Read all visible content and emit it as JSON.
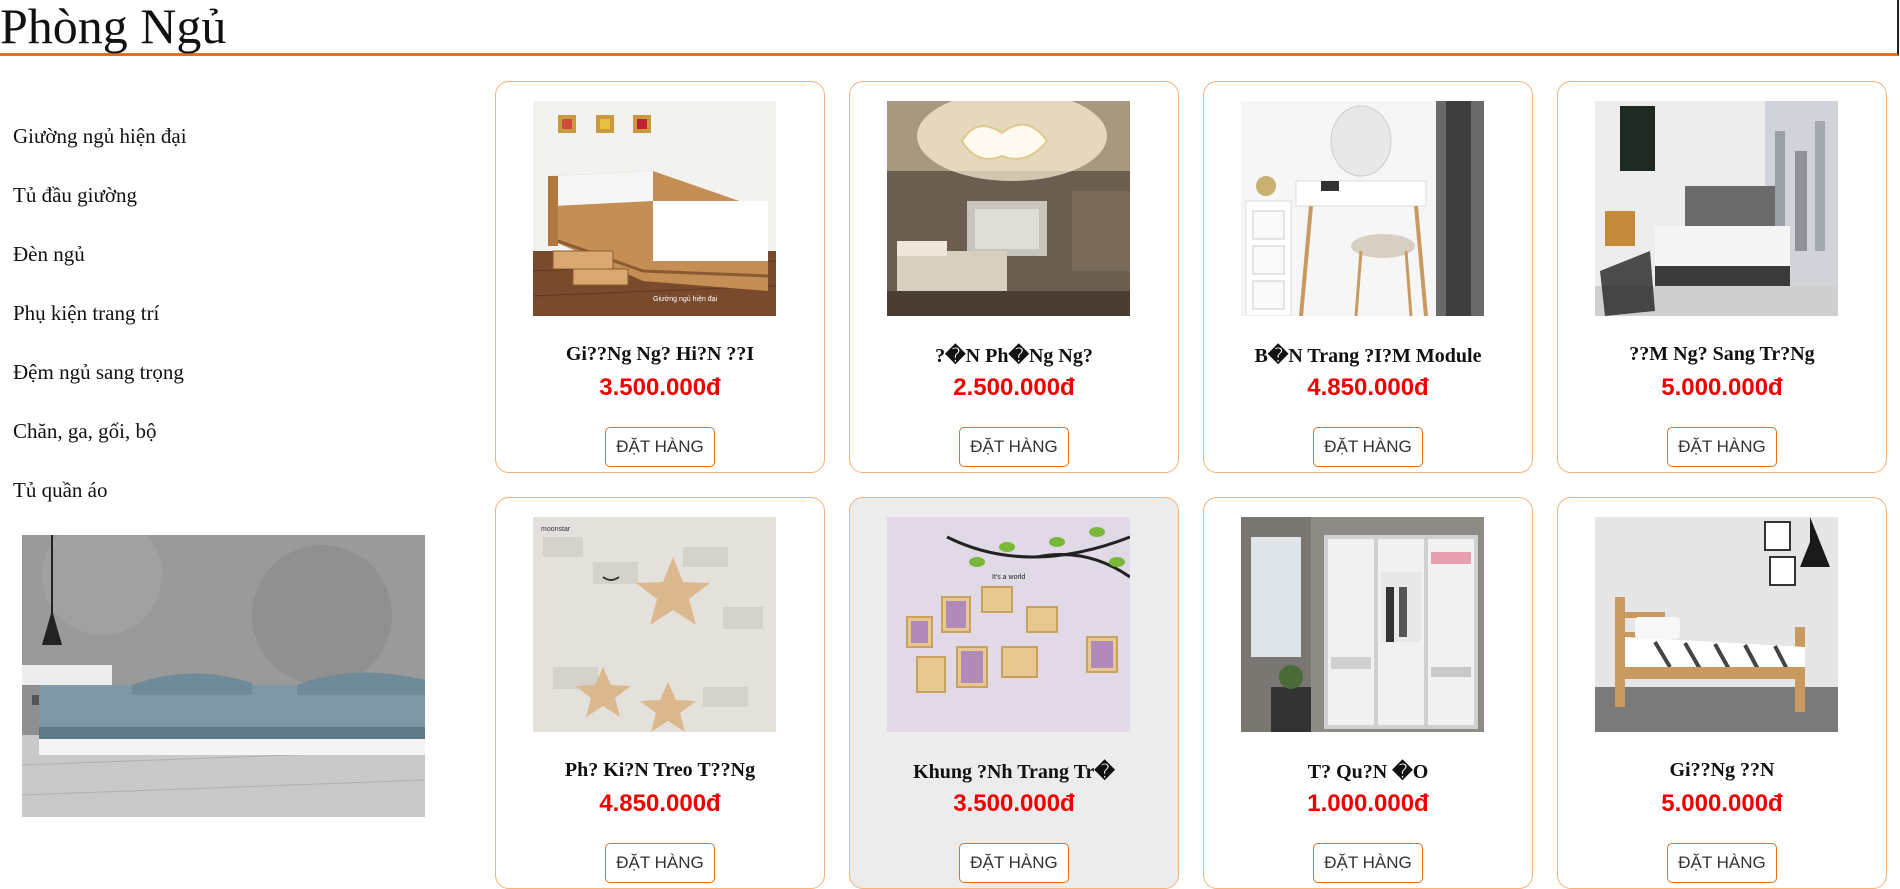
{
  "page": {
    "title": "Phòng Ngủ"
  },
  "sidebar": {
    "items": [
      {
        "label": "Giường ngủ hiện đại"
      },
      {
        "label": "Tủ đầu giường"
      },
      {
        "label": "Đèn ngủ"
      },
      {
        "label": "Phụ kiện trang trí"
      },
      {
        "label": "Đệm ngủ sang trọng"
      },
      {
        "label": "Chăn, ga, gối, bộ"
      },
      {
        "label": "Tủ quần áo"
      }
    ]
  },
  "products": [
    {
      "name": "Gi??Ng Ng? Hi?N ??I",
      "price": "3.500.000đ",
      "button": "ĐẶT HÀNG"
    },
    {
      "name": "?�N Ph�Ng Ng?",
      "price": "2.500.000đ",
      "button": "ĐẶT HÀNG"
    },
    {
      "name": "B�N Trang ?I?M Module",
      "price": "4.850.000đ",
      "button": "ĐẶT HÀNG"
    },
    {
      "name": "??M Ng? Sang Tr?Ng",
      "price": "5.000.000đ",
      "button": "ĐẶT HÀNG"
    },
    {
      "name": "Ph? Ki?N Treo T??Ng",
      "price": "4.850.000đ",
      "button": "ĐẶT HÀNG"
    },
    {
      "name": "Khung ?Nh Trang Tr�",
      "price": "3.500.000đ",
      "button": "ĐẶT HÀNG"
    },
    {
      "name": "T? Qu?N �O",
      "price": "1.000.000đ",
      "button": "ĐẶT HÀNG"
    },
    {
      "name": "Gi??Ng ??N",
      "price": "5.000.000đ",
      "button": "ĐẶT HÀNG"
    }
  ],
  "colors": {
    "accent": "#e0711c",
    "price": "#f00000",
    "card_border": "#f5b27a"
  }
}
